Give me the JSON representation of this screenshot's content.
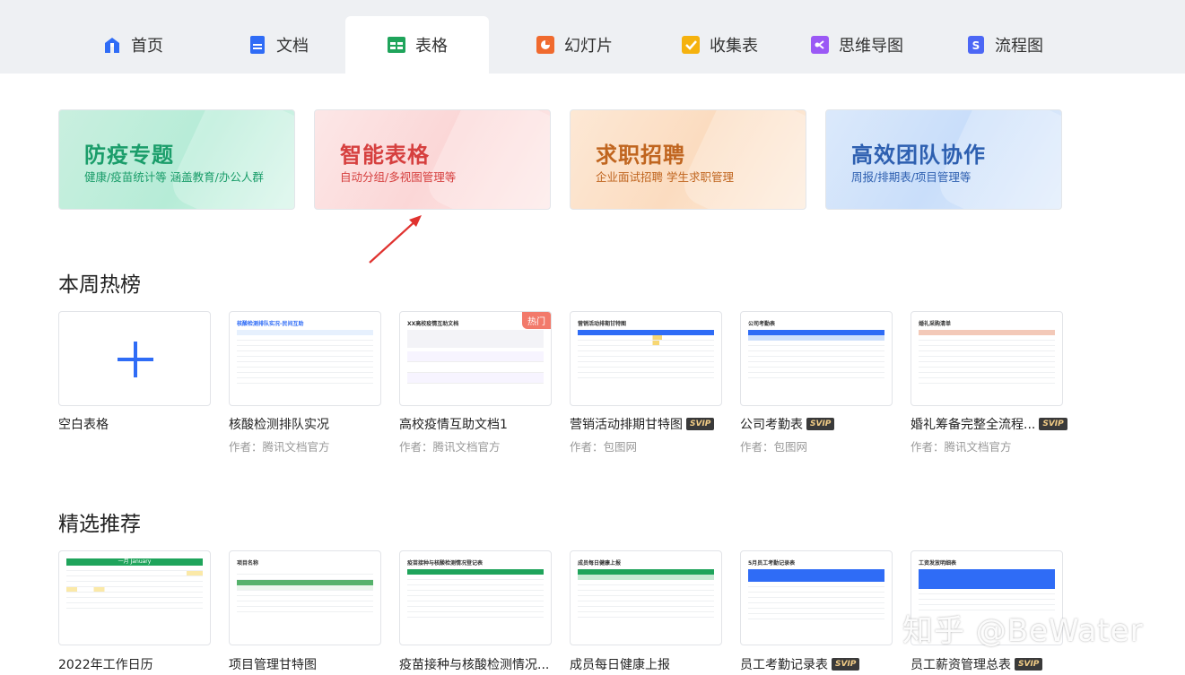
{
  "tabs": [
    {
      "label": "首页",
      "icon": "home-icon",
      "color": "#2f6cf6"
    },
    {
      "label": "文档",
      "icon": "doc-icon",
      "color": "#2f6cf6"
    },
    {
      "label": "表格",
      "icon": "sheet-icon",
      "color": "#1fa45b",
      "active": true
    },
    {
      "label": "幻灯片",
      "icon": "slides-icon",
      "color": "#f06a2e"
    },
    {
      "label": "收集表",
      "icon": "form-icon",
      "color": "#f5b20e"
    },
    {
      "label": "思维导图",
      "icon": "mindmap-icon",
      "color": "#9b59f5"
    },
    {
      "label": "流程图",
      "icon": "flowchart-icon",
      "color": "#4c67f5"
    }
  ],
  "banners": [
    {
      "title": "防疫专题",
      "subtitle": "健康/疫苗统计等  涵盖教育/办公人群"
    },
    {
      "title": "智能表格",
      "subtitle": "自动分组/多视图管理等"
    },
    {
      "title": "求职招聘",
      "subtitle": "企业面试招聘 学生求职管理"
    },
    {
      "title": "高效团队协作",
      "subtitle": "周报/排期表/项目管理等"
    }
  ],
  "weekly_hot": {
    "title": "本周热榜",
    "cards": [
      {
        "name": "空白表格",
        "author": "",
        "svip": false
      },
      {
        "name": "核酸检测排队实况",
        "author": "作者：腾讯文档官方",
        "svip": false,
        "thumb_title": "核酸检测排队实况-民间互助"
      },
      {
        "name": "高校疫情互助文档1",
        "author": "作者：腾讯文档官方",
        "svip": false,
        "hot": "热门",
        "thumb_title": "XX高校疫情互助文档"
      },
      {
        "name": "营销活动排期甘特图",
        "author": "作者：包图网",
        "svip": true,
        "thumb_title": "营销活动排期甘特图"
      },
      {
        "name": "公司考勤表",
        "author": "作者：包图网",
        "svip": true,
        "thumb_title": "公司考勤表"
      },
      {
        "name": "婚礼筹备完整全流程...",
        "author": "作者：腾讯文档官方",
        "svip": true,
        "thumb_title": "婚礼采购清单"
      }
    ]
  },
  "recommended": {
    "title": "精选推荐",
    "cards": [
      {
        "name": "2022年工作日历",
        "svip": false,
        "thumb_title": "一月 January"
      },
      {
        "name": "项目管理甘特图",
        "svip": false,
        "thumb_title": "项目名称"
      },
      {
        "name": "疫苗接种与核酸检测情况...",
        "svip": false,
        "thumb_title": "疫苗接种与核酸检测情况登记表"
      },
      {
        "name": "成员每日健康上报",
        "svip": false,
        "thumb_title": "成员每日健康上报"
      },
      {
        "name": "员工考勤记录表",
        "svip": true,
        "thumb_title": "5月员工考勤记录表"
      },
      {
        "name": "员工薪资管理总表",
        "svip": true,
        "thumb_title": "工资发放明细表"
      }
    ]
  },
  "svip_label": "SVIP",
  "watermark": "知乎 @BeWater"
}
